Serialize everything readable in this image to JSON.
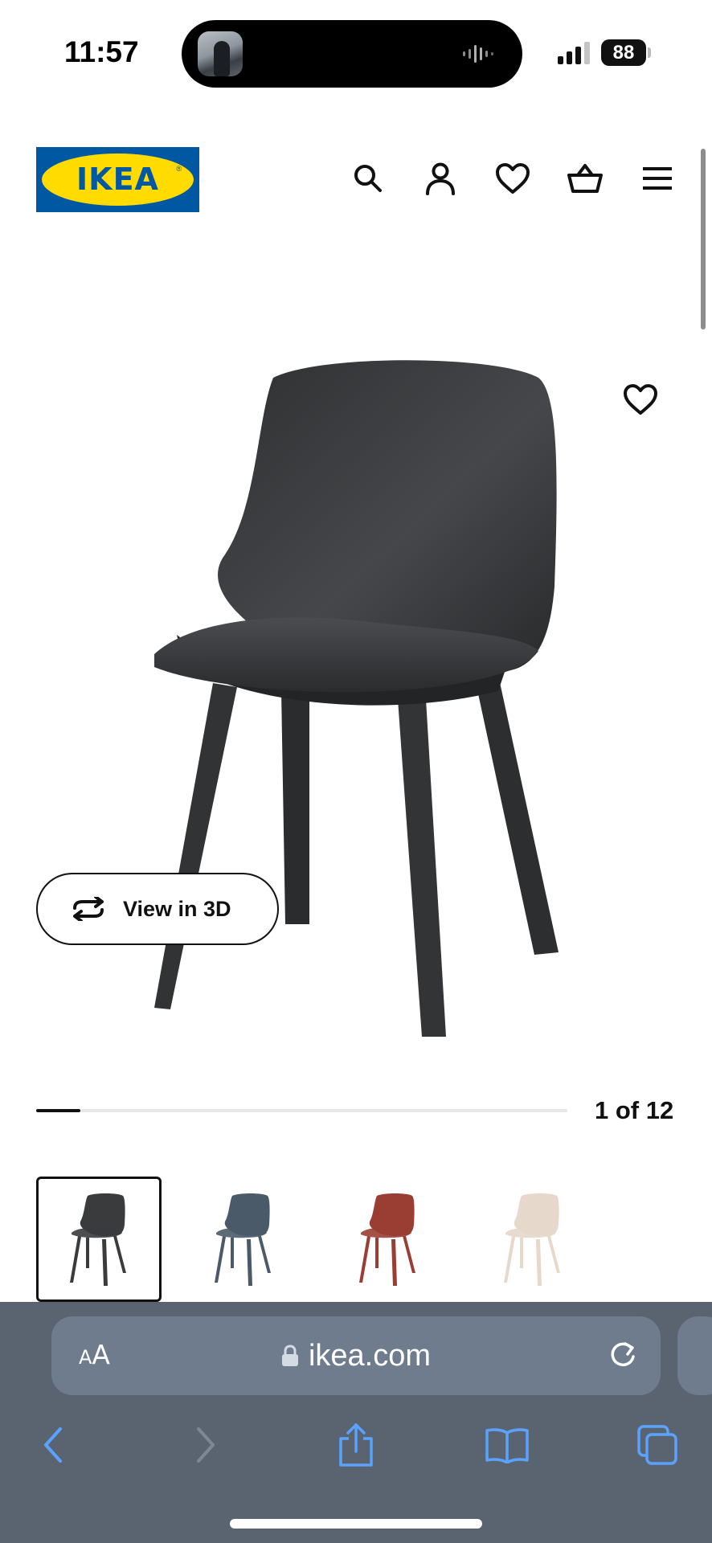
{
  "status_bar": {
    "time": "11:57",
    "battery": "88",
    "icons": [
      "signal-icon",
      "battery-icon",
      "audio-wave-icon"
    ]
  },
  "header": {
    "logo_text": "IKEA",
    "logo_colors": {
      "blue": "#0058a3",
      "yellow": "#ffdb00"
    },
    "icons": [
      "search-icon",
      "account-icon",
      "favorites-icon",
      "basket-icon",
      "menu-icon"
    ]
  },
  "product": {
    "image_icon": "chair-image",
    "chair_color": "#3a3b3d",
    "view3d_label": "View in 3D",
    "view3d_icon": "rotate-3d-icon",
    "favorite_icon": "heart-icon"
  },
  "gallery": {
    "counter": "1 of 12",
    "progress_fraction": 0.0833,
    "thumbnails": [
      {
        "color_name": "anthracite",
        "color": "#3a3b3d",
        "selected": true
      },
      {
        "color_name": "blue",
        "color": "#4b5a69",
        "selected": false
      },
      {
        "color_name": "red",
        "color": "#9a3e33",
        "selected": false
      },
      {
        "color_name": "white/beige",
        "color": "#e6d8cb",
        "selected": false
      }
    ]
  },
  "browser": {
    "text_size_label_small": "A",
    "text_size_label_big": "A",
    "url": "ikea.com",
    "accent": "#5ba2ff",
    "toolbar_icons": [
      "back-icon",
      "forward-icon",
      "share-icon",
      "bookmarks-icon",
      "tabs-icon"
    ]
  }
}
